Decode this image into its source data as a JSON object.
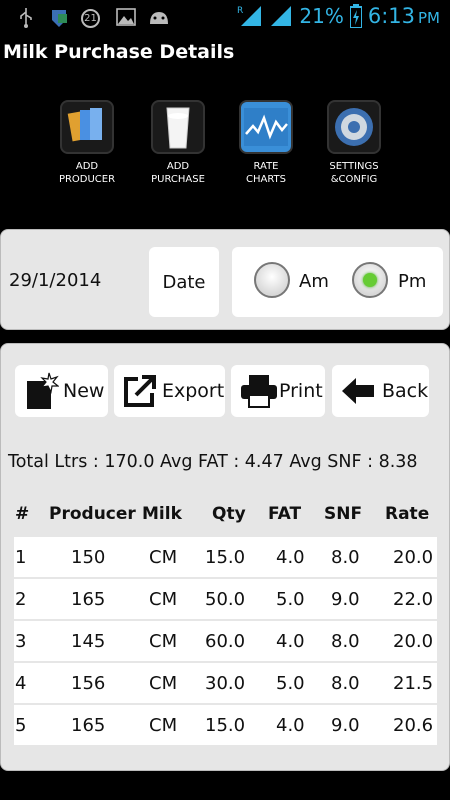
{
  "status": {
    "battery": "21%",
    "time": "6:13",
    "ampm": "PM",
    "notification_count": "21"
  },
  "title": "Milk Purchase Details",
  "toolbar": [
    {
      "line1": "ADD",
      "line2": "PRODUCER"
    },
    {
      "line1": "ADD",
      "line2": "PURCHASE"
    },
    {
      "line1": "RATE",
      "line2": "CHARTS"
    },
    {
      "line1": "SETTINGS",
      "line2": "&CONFIG"
    }
  ],
  "date_panel": {
    "date_value": "29/1/2014",
    "date_button": "Date",
    "am_label": "Am",
    "pm_label": "Pm",
    "selected": "Pm"
  },
  "actions": {
    "new": "New",
    "export": "Export",
    "print": "Print",
    "back": "Back"
  },
  "summary": "Total Ltrs : 170.0 Avg FAT : 4.47   Avg SNF : 8.38",
  "table": {
    "headers": [
      "#",
      "Producer",
      "Milk",
      "Qty",
      "FAT",
      "SNF",
      "Rate"
    ],
    "rows": [
      [
        "1",
        "150",
        "CM",
        "15.0",
        "4.0",
        "8.0",
        "20.0"
      ],
      [
        "2",
        "165",
        "CM",
        "50.0",
        "5.0",
        "9.0",
        "22.0"
      ],
      [
        "3",
        "145",
        "CM",
        "60.0",
        "4.0",
        "8.0",
        "20.0"
      ],
      [
        "4",
        "156",
        "CM",
        "30.0",
        "5.0",
        "8.0",
        "21.5"
      ],
      [
        "5",
        "165",
        "CM",
        "15.0",
        "4.0",
        "9.0",
        "20.6"
      ]
    ]
  },
  "colors": {
    "accent": "#33b5e5",
    "radio_selected": "#66cc33",
    "panel": "#e6e6e6"
  }
}
